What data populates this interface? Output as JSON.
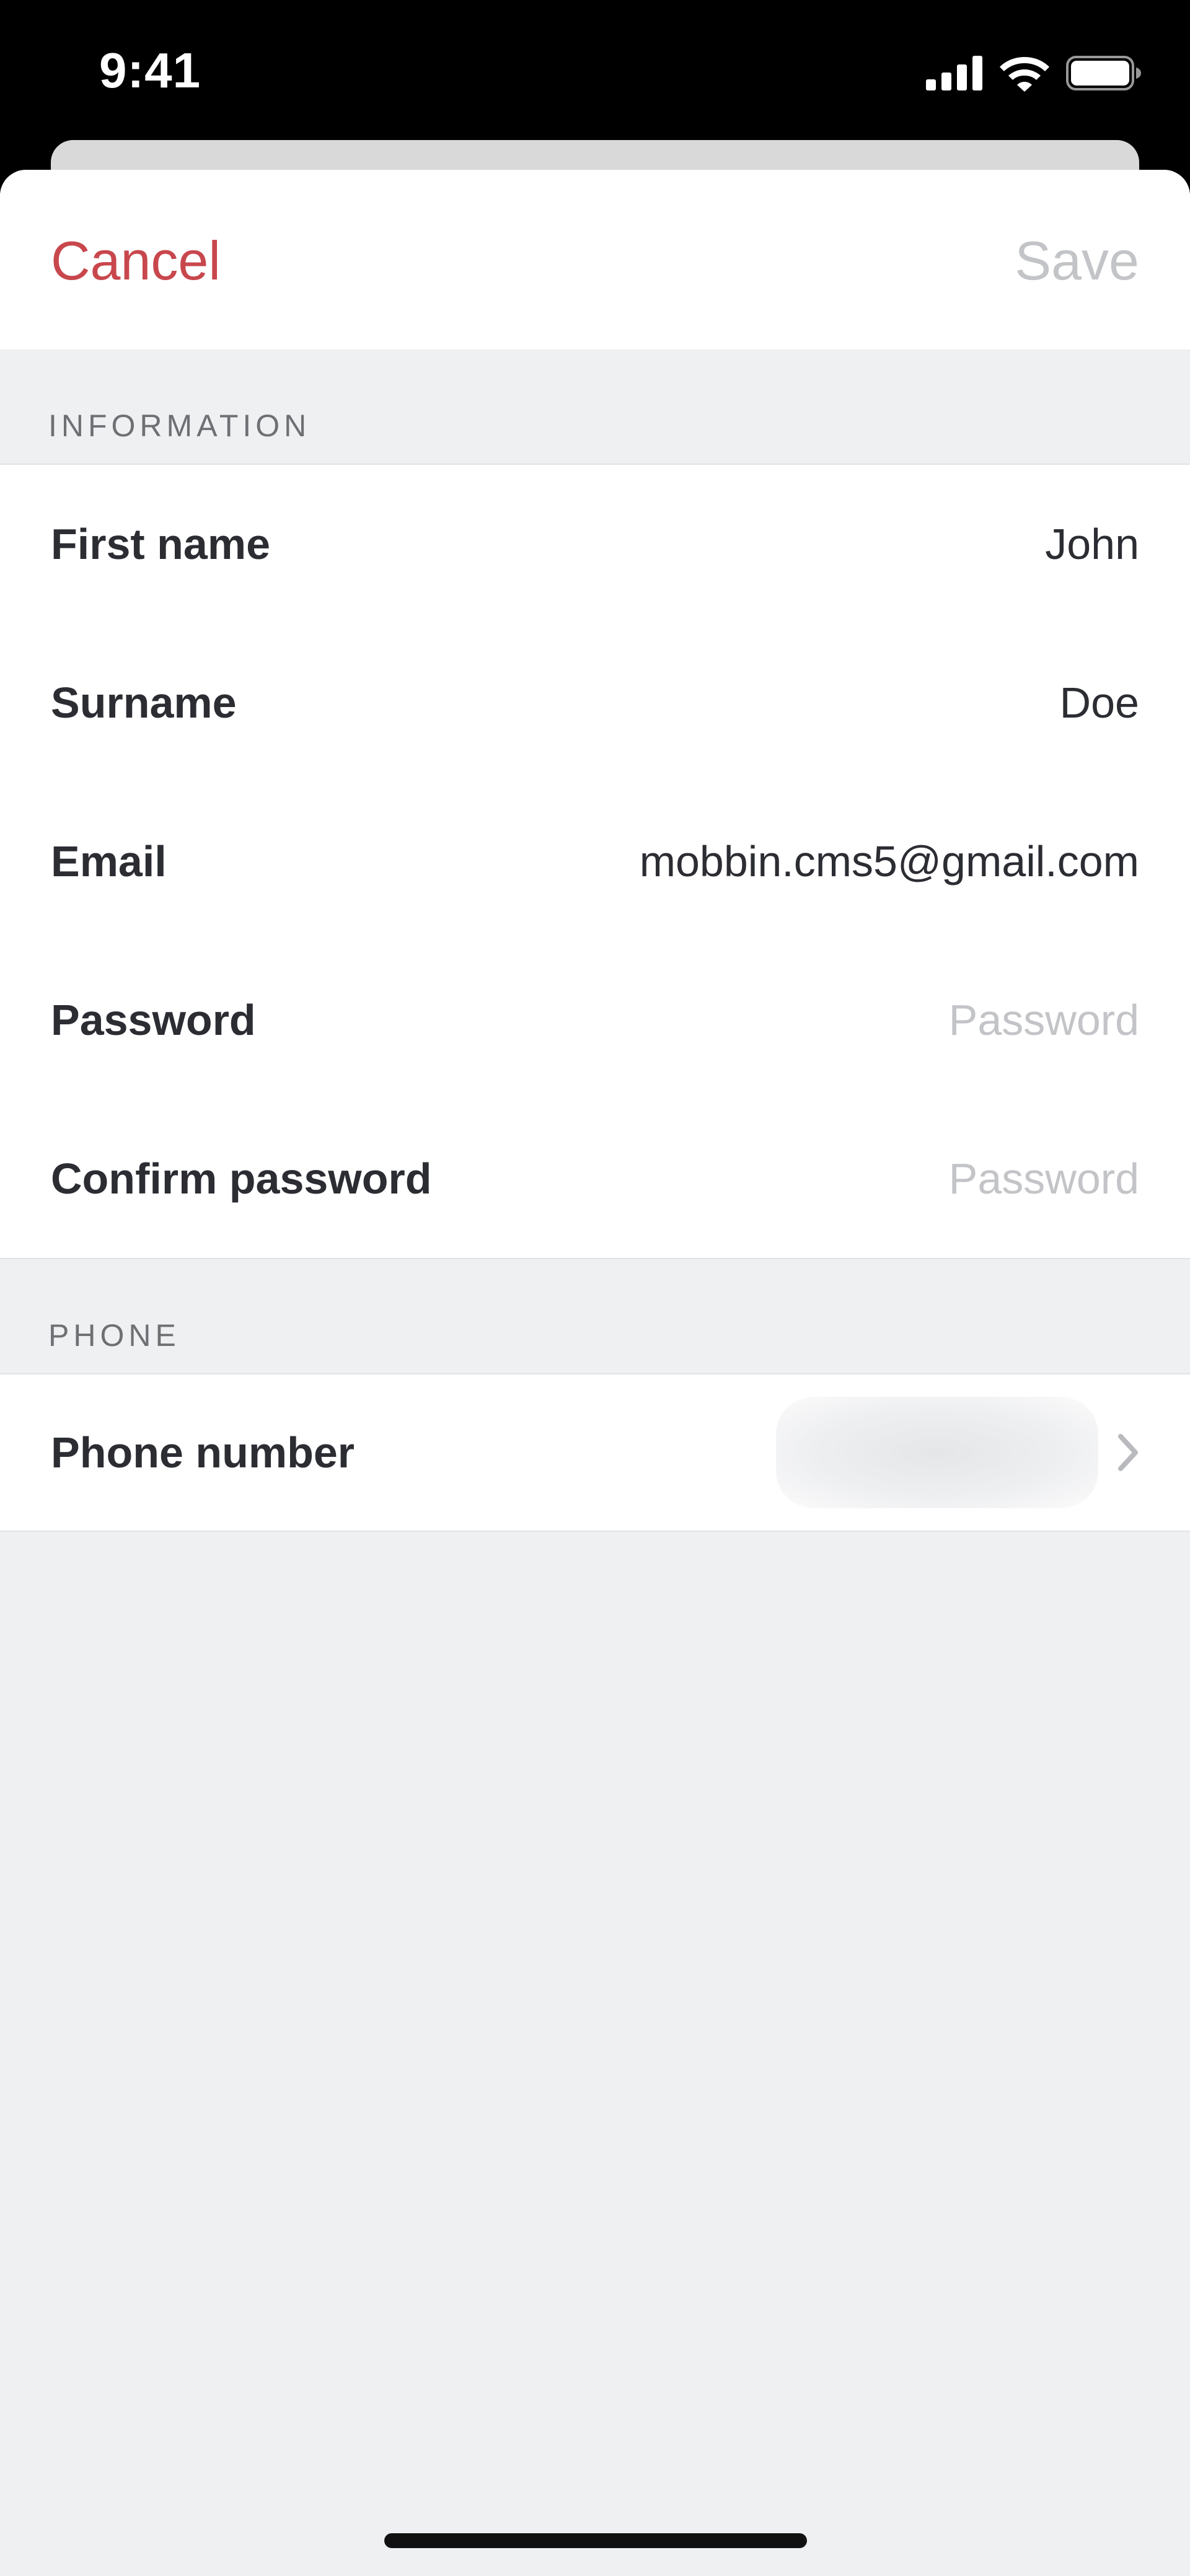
{
  "status_bar": {
    "time": "9:41",
    "icons": [
      "cellular-signal-icon",
      "wifi-icon",
      "battery-icon"
    ]
  },
  "header": {
    "cancel_label": "Cancel",
    "save_label": "Save"
  },
  "sections": {
    "information": {
      "title": "INFORMATION",
      "rows": [
        {
          "label": "First name",
          "value": "John",
          "placeholder": ""
        },
        {
          "label": "Surname",
          "value": "Doe",
          "placeholder": ""
        },
        {
          "label": "Email",
          "value": "mobbin.cms5@gmail.com",
          "placeholder": ""
        },
        {
          "label": "Password",
          "value": "",
          "placeholder": "Password"
        },
        {
          "label": "Confirm password",
          "value": "",
          "placeholder": "Password"
        }
      ]
    },
    "phone": {
      "title": "PHONE",
      "row": {
        "label": "Phone number",
        "icon": "chevron-right-icon"
      }
    }
  },
  "colors": {
    "accent": "#c8474d",
    "disabled": "#c3c4c7",
    "text": "#2b2d33",
    "section_header": "#6e7074",
    "background": "#eff0f2"
  }
}
